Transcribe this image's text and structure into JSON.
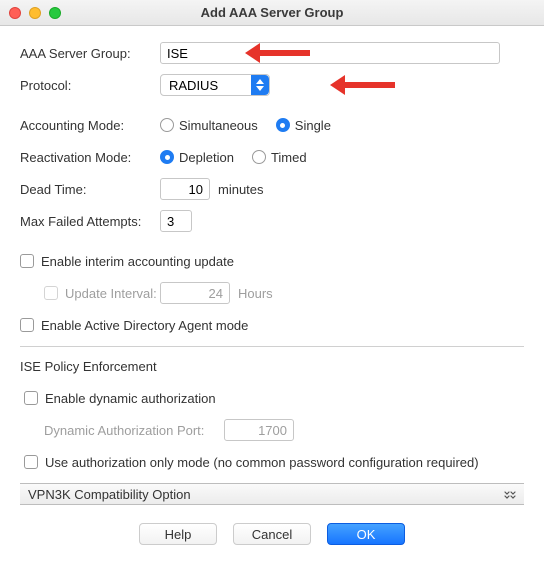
{
  "window": {
    "title": "Add AAA Server Group"
  },
  "labels": {
    "server_group": "AAA Server Group:",
    "protocol": "Protocol:",
    "accounting_mode": "Accounting Mode:",
    "reactivation_mode": "Reactivation Mode:",
    "dead_time": "Dead Time:",
    "dead_time_unit": "minutes",
    "max_failed": "Max Failed Attempts:",
    "interim": "Enable interim accounting update",
    "update_interval": "Update Interval:",
    "update_interval_unit": "Hours",
    "ad_agent": "Enable Active Directory Agent mode",
    "ise_section": "ISE Policy Enforcement",
    "dynamic_auth": "Enable dynamic authorization",
    "dyn_auth_port": "Dynamic Authorization Port:",
    "auth_only": "Use authorization only mode (no common password configuration required)",
    "accordion": "VPN3K Compatibility Option"
  },
  "values": {
    "server_group": "ISE",
    "protocol": "RADIUS",
    "dead_time": "10",
    "max_failed": "3",
    "update_interval": "24",
    "dyn_auth_port": "1700"
  },
  "radios": {
    "acct_simultaneous": "Simultaneous",
    "acct_single": "Single",
    "react_depletion": "Depletion",
    "react_timed": "Timed"
  },
  "buttons": {
    "help": "Help",
    "cancel": "Cancel",
    "ok": "OK"
  }
}
